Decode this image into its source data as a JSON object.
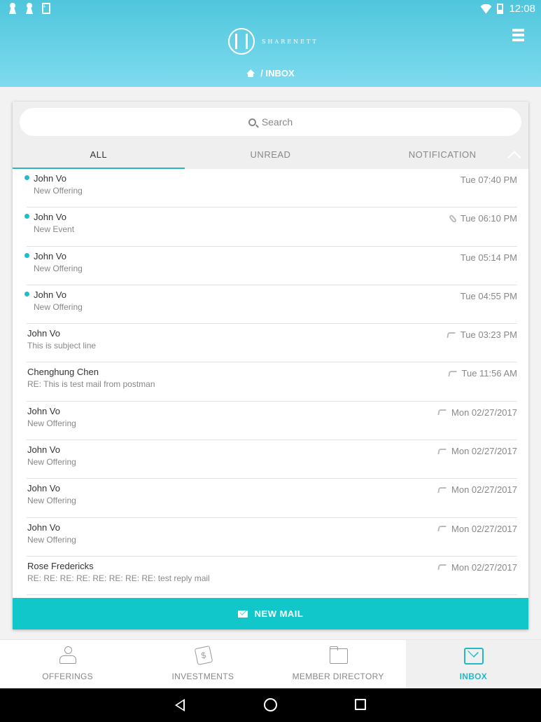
{
  "status": {
    "time": "12:08"
  },
  "header": {
    "brand": "SHARENETT",
    "breadcrumb": "/ INBOX"
  },
  "search": {
    "placeholder": "Search"
  },
  "tabs": [
    {
      "label": "ALL",
      "active": true
    },
    {
      "label": "UNREAD",
      "active": false
    },
    {
      "label": "NOTIFICATION",
      "active": false
    }
  ],
  "messages": [
    {
      "sender": "John Vo",
      "subject": "New Offering",
      "date": "Tue 07:40 PM",
      "unread": true,
      "icon": ""
    },
    {
      "sender": "John Vo",
      "subject": "New Event",
      "date": "Tue 06:10 PM",
      "unread": true,
      "icon": "paperclip-icon"
    },
    {
      "sender": "John Vo",
      "subject": "New Offering",
      "date": "Tue 05:14 PM",
      "unread": true,
      "icon": ""
    },
    {
      "sender": "John Vo",
      "subject": "New Offering",
      "date": "Tue 04:55 PM",
      "unread": true,
      "icon": ""
    },
    {
      "sender": "John Vo",
      "subject": "This is subject line",
      "date": "Tue 03:23 PM",
      "unread": false,
      "icon": "reply-icon"
    },
    {
      "sender": "Chenghung Chen",
      "subject": "RE: This is test mail from postman",
      "date": "Tue 11:56 AM",
      "unread": false,
      "icon": "reply-icon"
    },
    {
      "sender": "John Vo",
      "subject": "New Offering",
      "date": "Mon 02/27/2017",
      "unread": false,
      "icon": "reply-icon"
    },
    {
      "sender": "John Vo",
      "subject": "New Offering",
      "date": "Mon 02/27/2017",
      "unread": false,
      "icon": "reply-icon"
    },
    {
      "sender": "John Vo",
      "subject": "New Offering",
      "date": "Mon 02/27/2017",
      "unread": false,
      "icon": "reply-icon"
    },
    {
      "sender": "John Vo",
      "subject": "New Offering",
      "date": "Mon 02/27/2017",
      "unread": false,
      "icon": "reply-icon"
    },
    {
      "sender": "Rose Fredericks",
      "subject": "RE: RE: RE: RE: RE: RE: RE: RE: test reply mail",
      "date": "Mon 02/27/2017",
      "unread": false,
      "icon": "reply-icon"
    }
  ],
  "new_mail": {
    "label": "NEW MAIL"
  },
  "bottom_nav": [
    {
      "label": "OFFERINGS",
      "icon": "offerings-icon",
      "active": false
    },
    {
      "label": "INVESTMENTS",
      "icon": "investments-icon",
      "active": false
    },
    {
      "label": "MEMBER DIRECTORY",
      "icon": "folder-icon",
      "active": false
    },
    {
      "label": "INBOX",
      "icon": "inbox-icon",
      "active": true
    }
  ],
  "colors": {
    "accent": "#12c7c9",
    "header_top": "#4fc6dc",
    "header_bottom": "#7fdbef",
    "unread_dot": "#1fbcc9"
  }
}
